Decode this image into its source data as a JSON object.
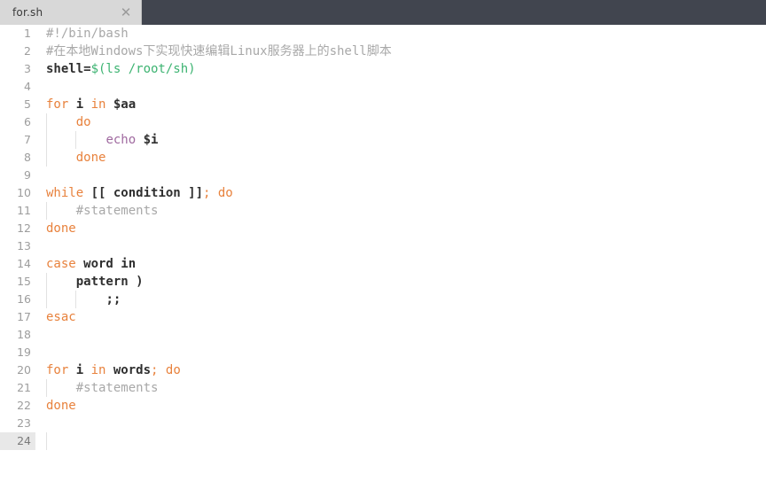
{
  "window": {
    "header_bg": "#41454f",
    "editor_bg": "#ffffff"
  },
  "tabbar": {
    "tabs": [
      {
        "label": "for.sh",
        "close_icon": "✕",
        "active": true
      }
    ]
  },
  "editor": {
    "language": "shell",
    "active_line": 24,
    "total_lines": 24,
    "colors": {
      "keyword": "#e8823d",
      "comment": "#a8a8a8",
      "string": "#3cb371",
      "function": "#a06aa0",
      "text": "#2f2f2f",
      "gutter": "#9d9d9d",
      "active_line_bg": "#e8e8e8"
    },
    "lines": [
      {
        "n": "1",
        "guides": 0,
        "tokens": [
          {
            "t": "comment",
            "v": "#!/bin/bash"
          }
        ]
      },
      {
        "n": "2",
        "guides": 0,
        "tokens": [
          {
            "t": "comment",
            "v": "#在本地Windows下实现快速编辑Linux服务器上的shell脚本"
          }
        ]
      },
      {
        "n": "3",
        "guides": 0,
        "tokens": [
          {
            "t": "plain",
            "v": "shell="
          },
          {
            "t": "string",
            "v": "$(ls /root/sh)"
          }
        ]
      },
      {
        "n": "4",
        "guides": 0,
        "tokens": []
      },
      {
        "n": "5",
        "guides": 0,
        "tokens": [
          {
            "t": "kw",
            "v": "for"
          },
          {
            "t": "plain",
            "v": " i "
          },
          {
            "t": "kw",
            "v": "in"
          },
          {
            "t": "plain",
            "v": " $aa"
          }
        ]
      },
      {
        "n": "6",
        "guides": 1,
        "tokens": [
          {
            "t": "txt",
            "v": "    "
          },
          {
            "t": "kw",
            "v": "do"
          }
        ]
      },
      {
        "n": "7",
        "guides": 2,
        "tokens": [
          {
            "t": "txt",
            "v": "        "
          },
          {
            "t": "func",
            "v": "echo"
          },
          {
            "t": "plain",
            "v": " $i"
          }
        ]
      },
      {
        "n": "8",
        "guides": 1,
        "tokens": [
          {
            "t": "txt",
            "v": "    "
          },
          {
            "t": "kw",
            "v": "done"
          }
        ]
      },
      {
        "n": "9",
        "guides": 0,
        "tokens": []
      },
      {
        "n": "10",
        "guides": 0,
        "tokens": [
          {
            "t": "kw",
            "v": "while"
          },
          {
            "t": "plain",
            "v": " [[ condition ]]"
          },
          {
            "t": "punc",
            "v": ";"
          },
          {
            "t": "kw",
            "v": " do"
          }
        ]
      },
      {
        "n": "11",
        "guides": 1,
        "tokens": [
          {
            "t": "txt",
            "v": "    "
          },
          {
            "t": "comment",
            "v": "#statements"
          }
        ]
      },
      {
        "n": "12",
        "guides": 0,
        "tokens": [
          {
            "t": "kw",
            "v": "done"
          }
        ]
      },
      {
        "n": "13",
        "guides": 0,
        "tokens": []
      },
      {
        "n": "14",
        "guides": 0,
        "tokens": [
          {
            "t": "kw",
            "v": "case"
          },
          {
            "t": "plain",
            "v": " word in"
          }
        ]
      },
      {
        "n": "15",
        "guides": 1,
        "tokens": [
          {
            "t": "txt",
            "v": "    "
          },
          {
            "t": "plain",
            "v": "pattern )"
          }
        ]
      },
      {
        "n": "16",
        "guides": 2,
        "tokens": [
          {
            "t": "txt",
            "v": "        "
          },
          {
            "t": "plain",
            "v": ";;"
          }
        ]
      },
      {
        "n": "17",
        "guides": 0,
        "tokens": [
          {
            "t": "kw",
            "v": "esac"
          }
        ]
      },
      {
        "n": "18",
        "guides": 0,
        "tokens": []
      },
      {
        "n": "19",
        "guides": 0,
        "tokens": []
      },
      {
        "n": "20",
        "guides": 0,
        "tokens": [
          {
            "t": "kw",
            "v": "for"
          },
          {
            "t": "plain",
            "v": " i "
          },
          {
            "t": "kw",
            "v": "in"
          },
          {
            "t": "plain",
            "v": " words"
          },
          {
            "t": "punc",
            "v": ";"
          },
          {
            "t": "kw",
            "v": " do"
          }
        ]
      },
      {
        "n": "21",
        "guides": 1,
        "tokens": [
          {
            "t": "txt",
            "v": "    "
          },
          {
            "t": "comment",
            "v": "#statements"
          }
        ]
      },
      {
        "n": "22",
        "guides": 0,
        "tokens": [
          {
            "t": "kw",
            "v": "done"
          }
        ]
      },
      {
        "n": "23",
        "guides": 0,
        "tokens": []
      },
      {
        "n": "24",
        "guides": 1,
        "tokens": []
      }
    ]
  }
}
